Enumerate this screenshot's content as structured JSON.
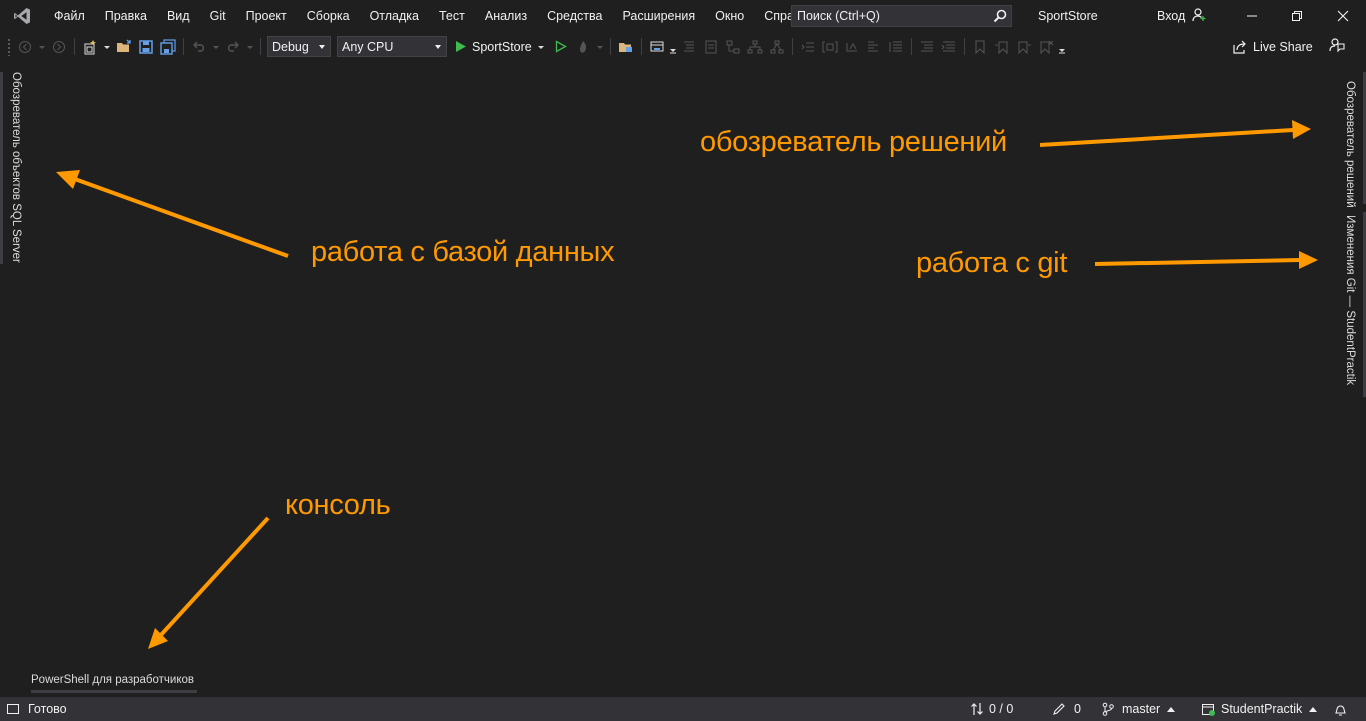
{
  "menu": {
    "items": [
      "Файл",
      "Правка",
      "Вид",
      "Git",
      "Проект",
      "Сборка",
      "Отладка",
      "Тест",
      "Анализ",
      "Средства",
      "Расширения",
      "Окно",
      "Справка"
    ]
  },
  "search": {
    "placeholder": "Поиск (Ctrl+Q)"
  },
  "title": {
    "solution": "SportStore",
    "signin": "Вход"
  },
  "toolbar": {
    "config": "Debug",
    "platform": "Any CPU",
    "run_label": "SportStore",
    "live_share": "Live Share",
    "run_color": "#3fb950"
  },
  "side_tabs": {
    "left": "Обозреватель объектов SQL Server",
    "right_top": "Обозреватель решений",
    "right_bottom": "Изменения Git — StudentPractik"
  },
  "bottom_tab": {
    "label": "PowerShell для разработчиков"
  },
  "annotations": {
    "db": "работа с базой данных",
    "solution": "обозреватель решений",
    "git": "работа с git",
    "console": "консоль",
    "color": "#ff9900"
  },
  "status": {
    "ready": "Готово",
    "sync": "0 / 0",
    "pending": "0",
    "branch": "master",
    "repo": "StudentPractik"
  }
}
